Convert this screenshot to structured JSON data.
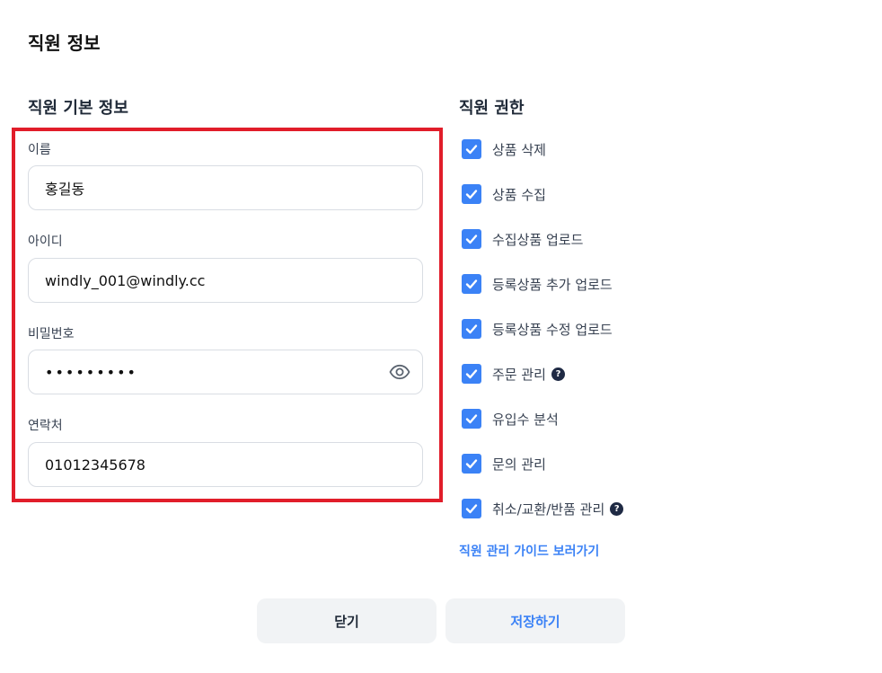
{
  "page": {
    "title": "직원 정보"
  },
  "basic_info": {
    "title": "직원 기본 정보",
    "fields": [
      {
        "label": "이름",
        "value": "홍길동"
      },
      {
        "label": "아이디",
        "value": "windly_001@windly.cc"
      },
      {
        "label": "비밀번호",
        "value": "•••••••••"
      },
      {
        "label": "연락처",
        "value": "01012345678"
      }
    ]
  },
  "permissions": {
    "title": "직원 권한",
    "items": [
      {
        "label": "상품 삭제",
        "checked": true
      },
      {
        "label": "상품 수집",
        "checked": true
      },
      {
        "label": "수집상품 업로드",
        "checked": true
      },
      {
        "label": "등록상품 추가 업로드",
        "checked": true
      },
      {
        "label": "등록상품 수정 업로드",
        "checked": true
      },
      {
        "label": "주문 관리",
        "checked": true,
        "help": "?"
      },
      {
        "label": "유입수 분석",
        "checked": true
      },
      {
        "label": "문의 관리",
        "checked": true
      },
      {
        "label": "취소/교환/반품 관리",
        "checked": true,
        "help": "?"
      }
    ],
    "guide_link": "직원 관리 가이드 보러가기"
  },
  "buttons": {
    "close": "닫기",
    "save": "저장하기"
  },
  "colors": {
    "accent": "#3b82f6",
    "highlight": "#e11d2a",
    "help_bg": "#1f2a44"
  }
}
